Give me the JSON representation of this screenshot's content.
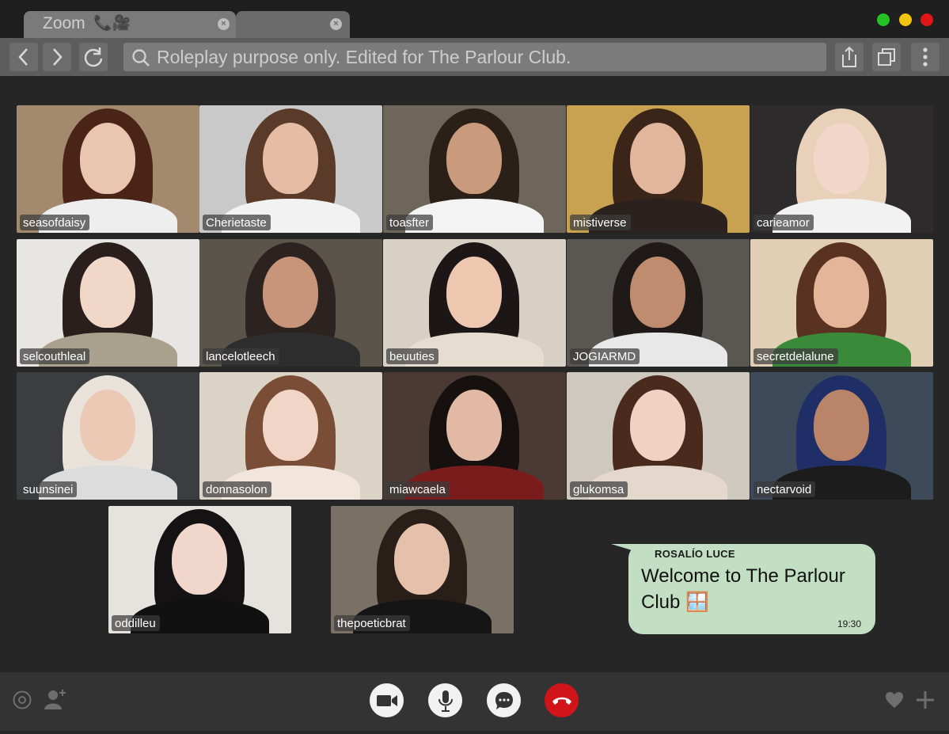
{
  "window": {
    "tabs": [
      {
        "title": "Zoom",
        "glyph": "📞🎥",
        "close": "×"
      },
      {
        "title": "",
        "glyph": "",
        "close": "×"
      }
    ],
    "traffic_lights": [
      "#22c322",
      "#f2c40f",
      "#e01515"
    ]
  },
  "toolbar": {
    "address": "Roleplay purpose only. Edited for The Parlour Club.",
    "icons": [
      "back-icon",
      "forward-icon",
      "reload-icon",
      "search-icon",
      "share-icon",
      "duplicate-icon",
      "more-icon"
    ]
  },
  "participants": [
    {
      "name": "seasofdaisy",
      "bg": "#a38a6e",
      "skin": "#e9c6b0",
      "hair": "#4a2416",
      "shirt": "#eeeeee"
    },
    {
      "name": "Cherietaste",
      "bg": "#c9c9c9",
      "skin": "#e6bca4",
      "hair": "#5a3a28",
      "shirt": "#f2f2f2"
    },
    {
      "name": "toasfter",
      "bg": "#6e665b",
      "skin": "#c99a7c",
      "hair": "#2a2018",
      "shirt": "#f3f3f3"
    },
    {
      "name": "mistiverse",
      "bg": "#c8a250",
      "skin": "#e2b69c",
      "hair": "#3b2418",
      "shirt": "#2b2220"
    },
    {
      "name": "carieamor",
      "bg": "#2d2b2b",
      "skin": "#f1d6c9",
      "hair": "#e8d1b8",
      "shirt": "#f2f2f2"
    },
    {
      "name": "selcouthleal",
      "bg": "#e8e6e2",
      "skin": "#f0d7c8",
      "hair": "#2a1f1c",
      "shirt": "#a9a08e"
    },
    {
      "name": "lancelotleech",
      "bg": "#5b544b",
      "skin": "#c8957a",
      "hair": "#2c2220",
      "shirt": "#2d2d2d"
    },
    {
      "name": "beuuties",
      "bg": "#d8d0c4",
      "skin": "#eec7b1",
      "hair": "#1d1616",
      "shirt": "#e6dccf"
    },
    {
      "name": "JOGIARMD",
      "bg": "#5a5652",
      "skin": "#bf8c70",
      "hair": "#1f1a18",
      "shirt": "#e8e8e8"
    },
    {
      "name": "secretdelalune",
      "bg": "#e0cfb4",
      "skin": "#e4b598",
      "hair": "#5a3222",
      "shirt": "#3a8a3a"
    },
    {
      "name": "suunsinei",
      "bg": "#3b3d40",
      "skin": "#ecc9b5",
      "hair": "#e8e2da",
      "shirt": "#dcdcdc"
    },
    {
      "name": "donnasolon",
      "bg": "#dcd3c7",
      "skin": "#f1d5c6",
      "hair": "#7a4e36",
      "shirt": "#f2e6dc"
    },
    {
      "name": "miawcaela",
      "bg": "#4a3a33",
      "skin": "#e2b9a4",
      "hair": "#16110f",
      "shirt": "#7a1c1c"
    },
    {
      "name": "glukomsa",
      "bg": "#cfc8be",
      "skin": "#f0d2c3",
      "hair": "#4a2a1d",
      "shirt": "#e4d8cc"
    },
    {
      "name": "nectarvoid",
      "bg": "#3c4a5a",
      "skin": "#b98468",
      "hair": "#1f2e66",
      "shirt": "#1c1c1c"
    },
    {
      "name": "oddilleu",
      "bg": "#e6e2de",
      "skin": "#f0d6cb",
      "hair": "#141212",
      "shirt": "#111111"
    },
    {
      "name": "thepoeticbrat",
      "bg": "#7a7064",
      "skin": "#e5c1ac",
      "hair": "#2a1e18",
      "shirt": "#151515"
    }
  ],
  "chat": {
    "sender": "ROSALÍO LUCE",
    "message": "Welcome to The Parlour Club 🪟",
    "time": "19:30"
  },
  "controls": {
    "left": [
      "settings-icon",
      "add-person-icon"
    ],
    "center": [
      "video-camera-icon",
      "microphone-icon",
      "chat-bubble-icon",
      "end-call-icon"
    ],
    "right": [
      "heart-icon",
      "plus-icon"
    ],
    "end_call_color": "#d0141a"
  }
}
